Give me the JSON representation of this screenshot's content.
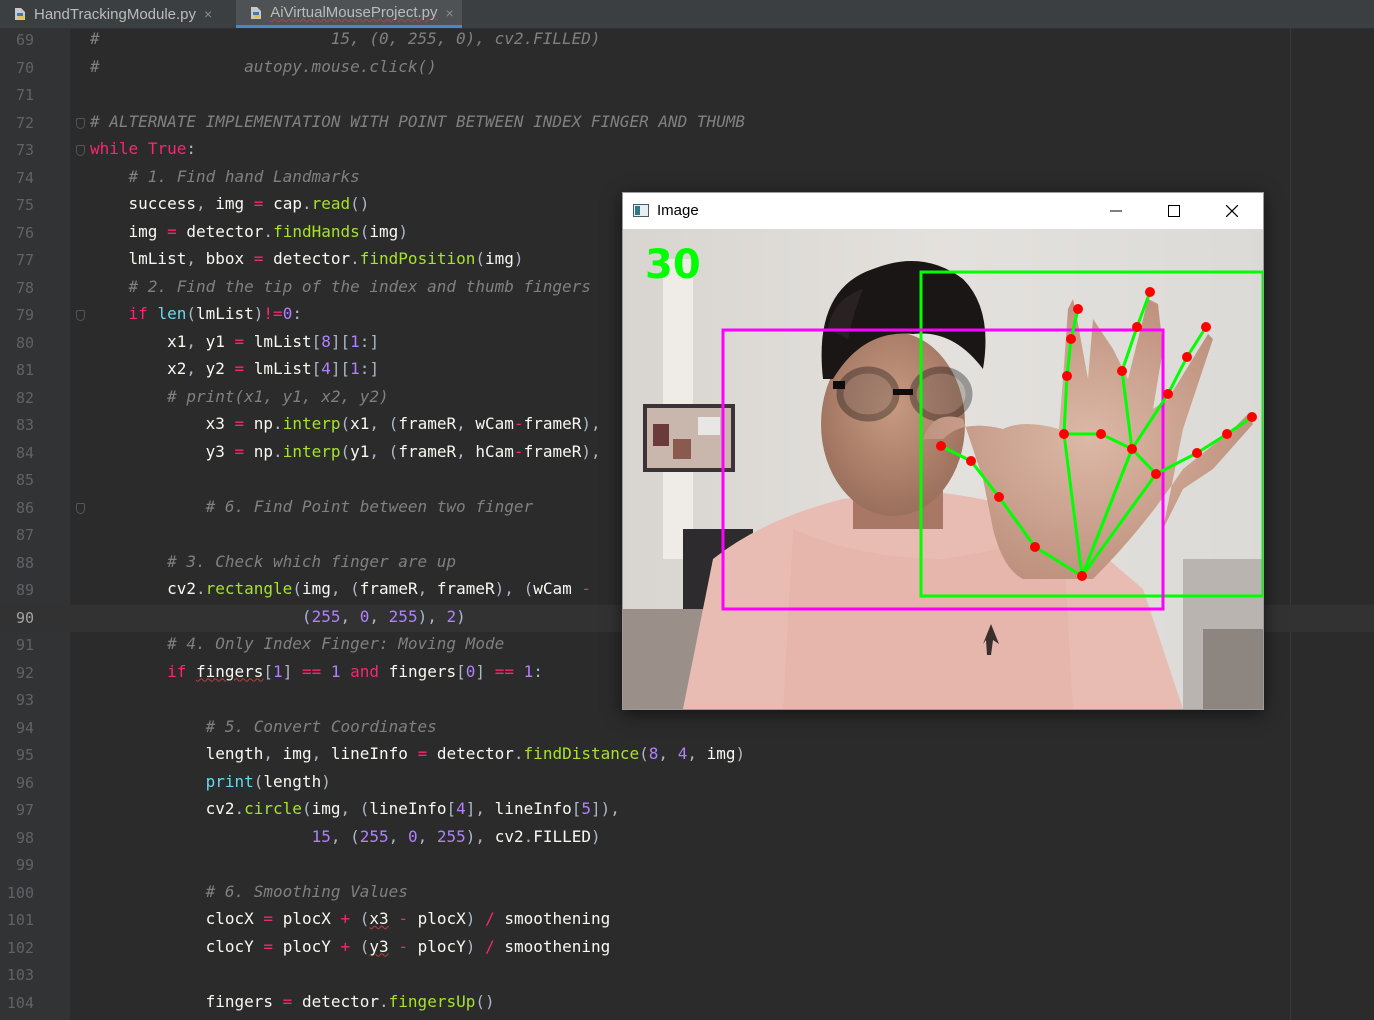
{
  "tabs": [
    {
      "label": "HandTrackingModule.py",
      "close": "×",
      "active": false
    },
    {
      "label": "AiVirtualMouseProject.py",
      "close": "×",
      "active": true
    }
  ],
  "window": {
    "title": "Image",
    "fps": "30"
  },
  "lines": [
    {
      "n": "69",
      "text": "#                        15, (0, 255, 0), cv2.FILLED)",
      "kind": "comment"
    },
    {
      "n": "70",
      "text": "#               autopy.mouse.click()",
      "kind": "comment"
    },
    {
      "n": "71",
      "text": "",
      "kind": "plain"
    },
    {
      "n": "72",
      "text": "# ALTERNATE IMPLEMENTATION WITH POINT BETWEEN INDEX FINGER AND THUMB",
      "kind": "comment"
    },
    {
      "n": "73",
      "text": "while True:",
      "kind": "while"
    },
    {
      "n": "74",
      "text": "    # 1. Find hand Landmarks",
      "kind": "comment"
    },
    {
      "n": "75",
      "text": "    success, img = cap.read()",
      "kind": "code"
    },
    {
      "n": "76",
      "text": "    img = detector.findHands(img)",
      "kind": "code"
    },
    {
      "n": "77",
      "text": "    lmList, bbox = detector.findPosition(img)",
      "kind": "code"
    },
    {
      "n": "78",
      "text": "    # 2. Find the tip of the index and thumb fingers",
      "kind": "comment"
    },
    {
      "n": "79",
      "text": "    if len(lmList)!=0:",
      "kind": "code"
    },
    {
      "n": "80",
      "text": "        x1, y1 = lmList[8][1:]",
      "kind": "code"
    },
    {
      "n": "81",
      "text": "        x2, y2 = lmList[4][1:]",
      "kind": "code"
    },
    {
      "n": "82",
      "text": "        # print(x1, y1, x2, y2)",
      "kind": "comment"
    },
    {
      "n": "83",
      "text": "            x3 = np.interp(x1, (frameR, wCam-frameR),",
      "kind": "code"
    },
    {
      "n": "84",
      "text": "            y3 = np.interp(y1, (frameR, hCam-frameR),",
      "kind": "code"
    },
    {
      "n": "85",
      "text": "",
      "kind": "plain"
    },
    {
      "n": "86",
      "text": "            # 6. Find Point between two finger",
      "kind": "comment"
    },
    {
      "n": "87",
      "text": "",
      "kind": "plain"
    },
    {
      "n": "88",
      "text": "        # 3. Check which finger are up",
      "kind": "comment"
    },
    {
      "n": "89",
      "text": "        cv2.rectangle(img, (frameR, frameR), (wCam - ",
      "kind": "code"
    },
    {
      "n": "90",
      "text": "                      (255, 0, 255), 2)",
      "kind": "code"
    },
    {
      "n": "91",
      "text": "        # 4. Only Index Finger: Moving Mode",
      "kind": "comment"
    },
    {
      "n": "92",
      "text": "        if fingers[1] == 1 and fingers[0] == 1:",
      "kind": "code"
    },
    {
      "n": "93",
      "text": "",
      "kind": "plain"
    },
    {
      "n": "94",
      "text": "            # 5. Convert Coordinates",
      "kind": "comment"
    },
    {
      "n": "95",
      "text": "            length, img, lineInfo = detector.findDistance(8, 4, img)",
      "kind": "code"
    },
    {
      "n": "96",
      "text": "            print(length)",
      "kind": "code"
    },
    {
      "n": "97",
      "text": "            cv2.circle(img, (lineInfo[4], lineInfo[5]),",
      "kind": "code"
    },
    {
      "n": "98",
      "text": "                       15, (255, 0, 255), cv2.FILLED)",
      "kind": "code"
    },
    {
      "n": "99",
      "text": "",
      "kind": "plain"
    },
    {
      "n": "100",
      "text": "            # 6. Smoothing Values",
      "kind": "comment"
    },
    {
      "n": "101",
      "text": "            clocX = plocX + (x3 - plocX) / smoothening",
      "kind": "code"
    },
    {
      "n": "102",
      "text": "            clocY = plocY + (y3 - plocY) / smoothening",
      "kind": "code"
    },
    {
      "n": "103",
      "text": "",
      "kind": "plain"
    },
    {
      "n": "104",
      "text": "            fingers = detector.fingersUp()",
      "kind": "code"
    }
  ],
  "current_line": "90",
  "colors": {
    "comment": "#808080",
    "keyword": "#f92672",
    "function": "#a6e22e",
    "number": "#ae81ff",
    "builtin": "#66d9ef",
    "bbox_green": "#00ff00",
    "bbox_magenta": "#ff00ff",
    "landmark": "#ff0000"
  }
}
